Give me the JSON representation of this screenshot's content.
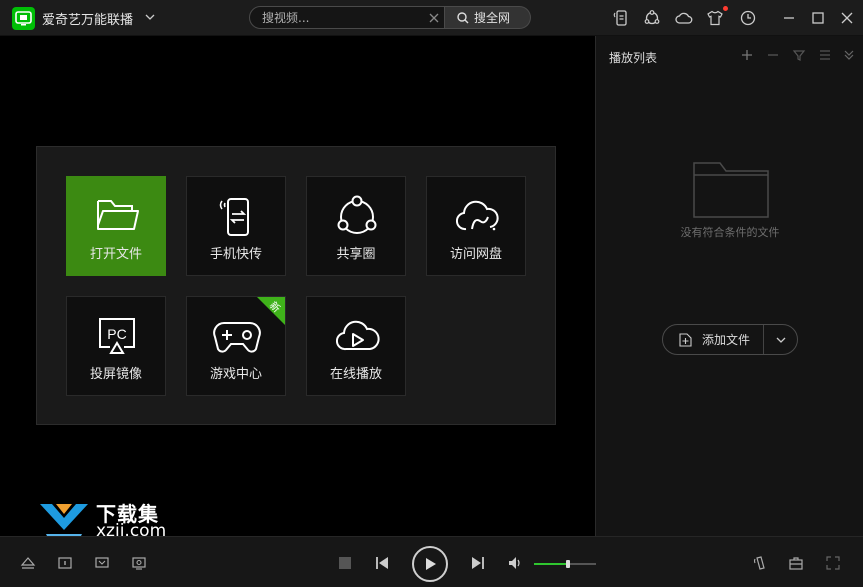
{
  "app": {
    "title": "爱奇艺万能联播",
    "logo_icon": "iqiyi-tv-logo-icon",
    "accent_color": "#00be06"
  },
  "search": {
    "placeholder": "搜视频...",
    "button_label": "搜全网"
  },
  "toolbar_icons": [
    "phone-cast-icon",
    "share-circle-icon",
    "cloud-icon",
    "skin-shirt-icon",
    "history-clock-icon",
    "minimize-icon",
    "maximize-icon",
    "close-icon"
  ],
  "launcher": {
    "tiles": [
      {
        "label": "打开文件",
        "icon": "folder-icon",
        "active": true
      },
      {
        "label": "手机快传",
        "icon": "phone-transfer-icon",
        "active": false
      },
      {
        "label": "共享圈",
        "icon": "share-circle-icon",
        "active": false
      },
      {
        "label": "访问网盘",
        "icon": "cloud-drive-icon",
        "active": false
      },
      {
        "label": "投屏镜像",
        "icon": "pc-mirror-icon",
        "active": false
      },
      {
        "label": "游戏中心",
        "icon": "gamepad-icon",
        "active": false,
        "badge": "新"
      },
      {
        "label": "在线播放",
        "icon": "cloud-play-icon",
        "active": false
      }
    ]
  },
  "playlist": {
    "title": "播放列表",
    "empty_text": "没有符合条件的文件",
    "add_file_label": "添加文件"
  },
  "watermark": {
    "title": "下载集",
    "url": "xzji.com"
  },
  "player": {
    "volume_level": 0.55
  }
}
